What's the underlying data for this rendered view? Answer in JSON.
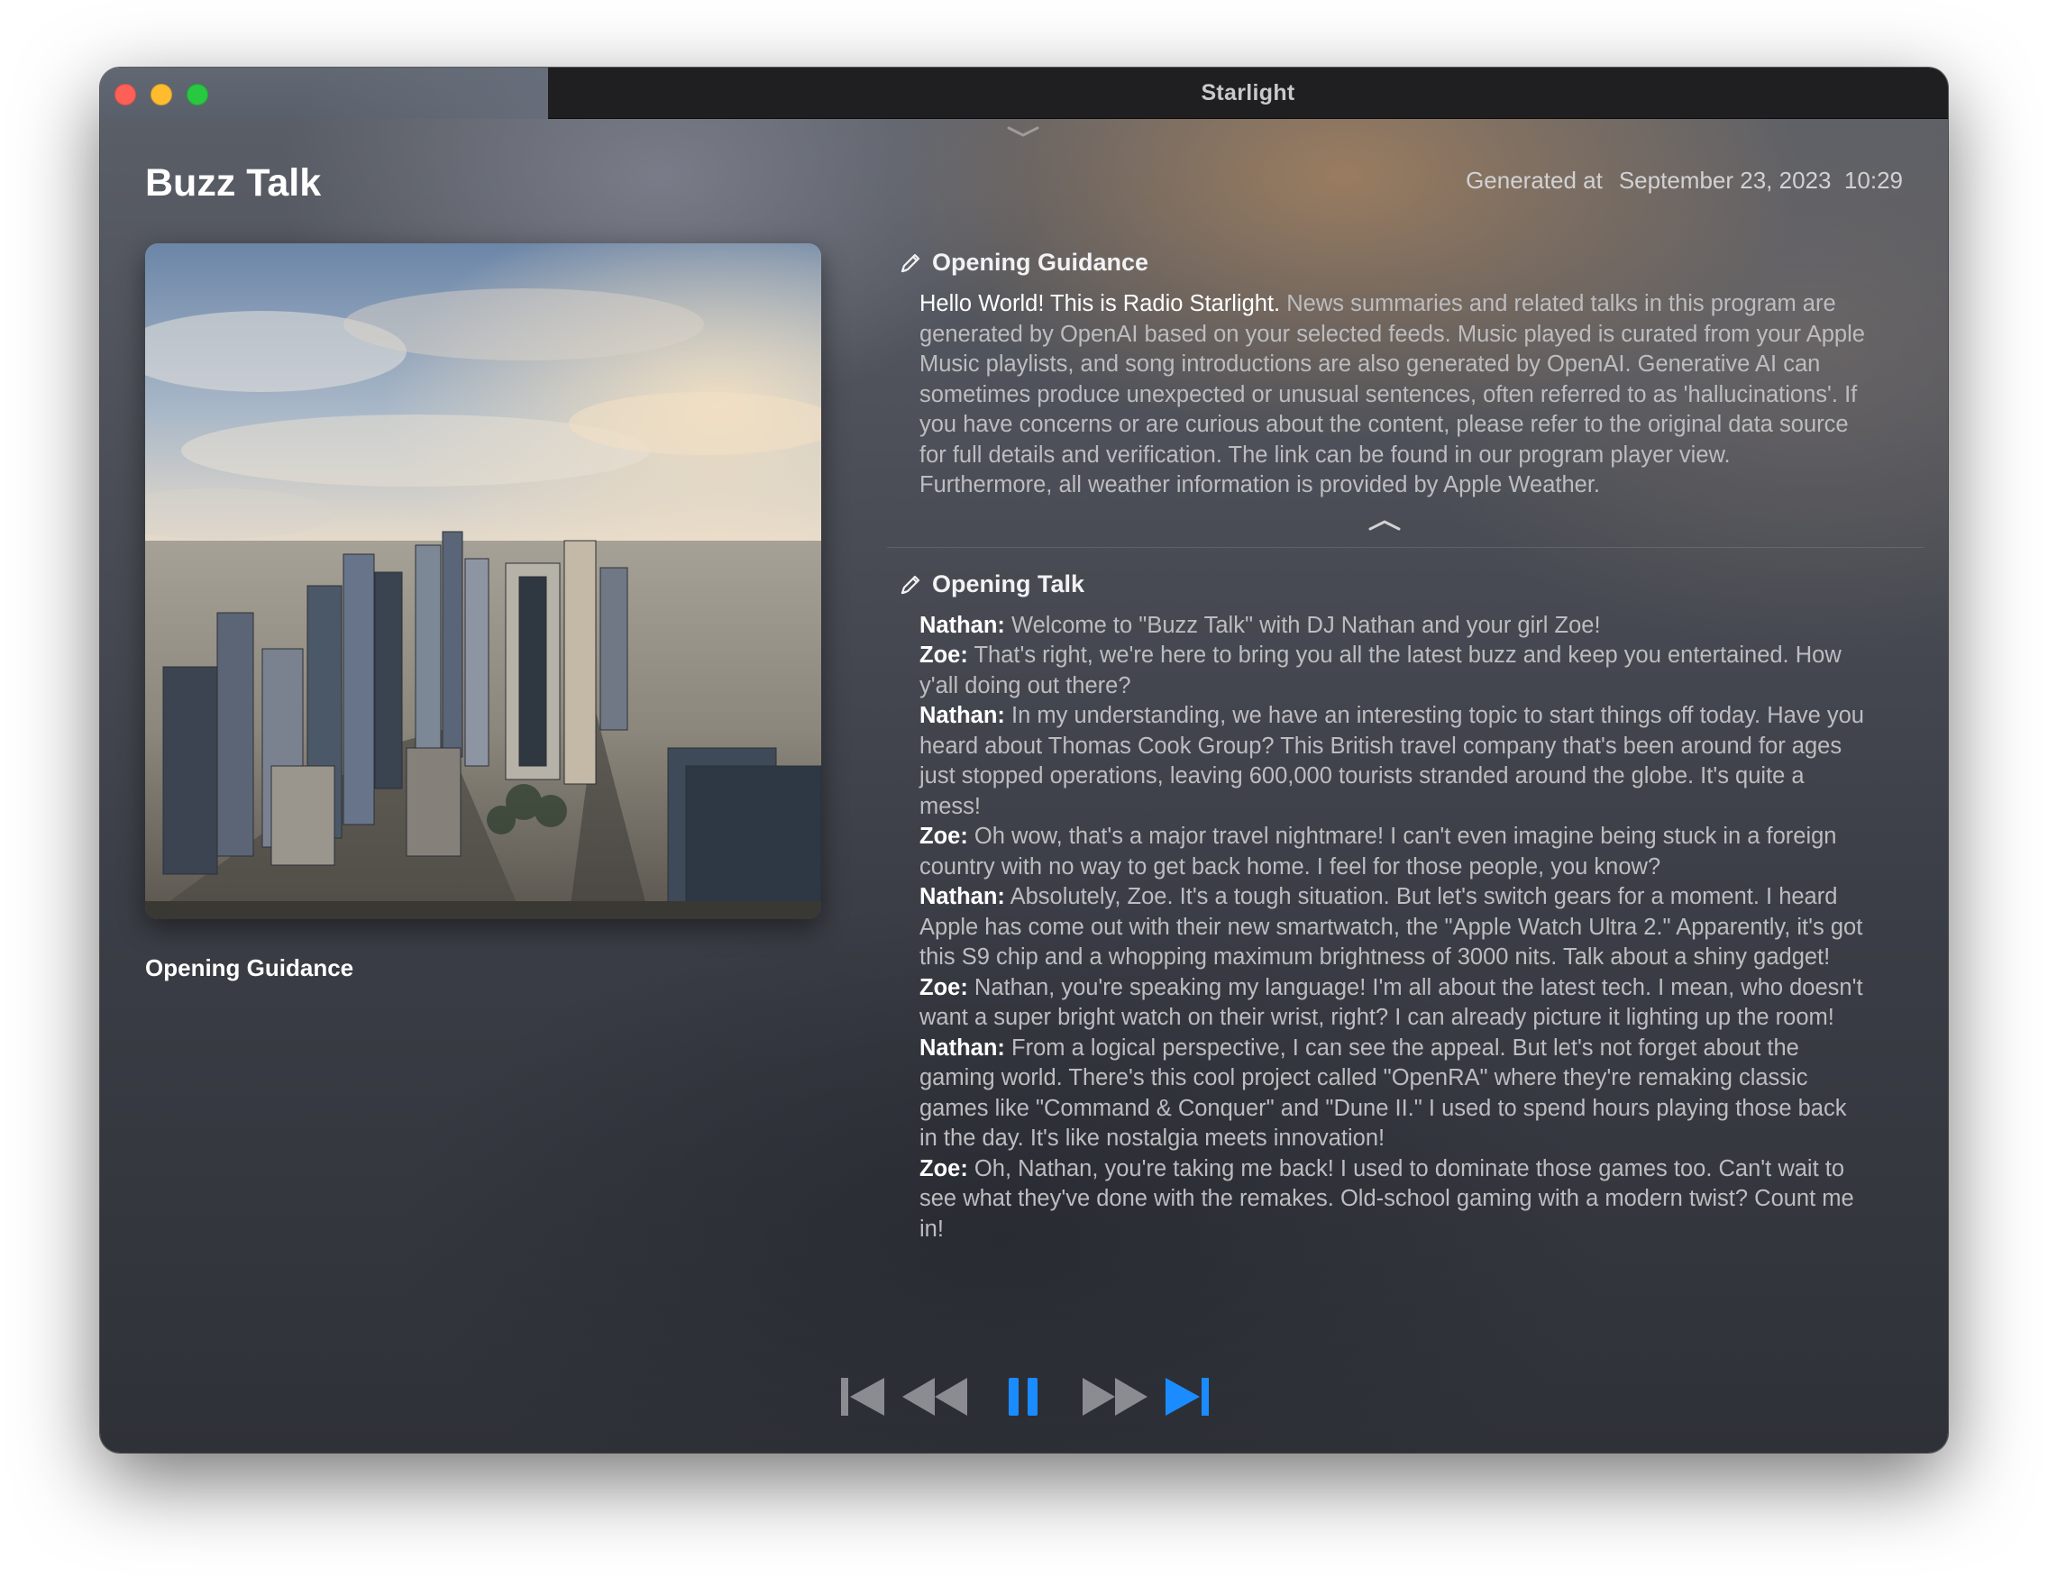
{
  "window": {
    "title": "Starlight"
  },
  "header": {
    "app_title": "Buzz Talk",
    "generated_label": "Generated at",
    "generated_date": "September 23, 2023",
    "generated_time": "10:29"
  },
  "artwork": {
    "caption": "Opening Guidance"
  },
  "sections": {
    "guidance": {
      "heading": "Opening Guidance",
      "lead": "Hello World! This is Radio Starlight.",
      "body": "News summaries and related talks in this program are generated by OpenAI based on your selected feeds. Music played is curated from your Apple Music playlists, and song introductions are also generated by OpenAI. Generative AI can sometimes produce unexpected or unusual sentences, often referred to as 'hallucinations'. If you have concerns or are curious about the content, please refer to the original data source for full details and verification. The link can be found in our program player view. Furthermore, all weather information is provided by Apple Weather."
    },
    "talk": {
      "heading": "Opening Talk",
      "lines": [
        {
          "speaker": "Nathan:",
          "text": "Welcome to \"Buzz Talk\" with DJ Nathan and your girl Zoe!"
        },
        {
          "speaker": "Zoe:",
          "text": "That's right, we're here to bring you all the latest buzz and keep you entertained. How y'all doing out there?"
        },
        {
          "speaker": "Nathan:",
          "text": "In my understanding, we have an interesting topic to start things off today. Have you heard about Thomas Cook Group? This British travel company that's been around for ages just stopped operations, leaving 600,000 tourists stranded around the globe. It's quite a mess!"
        },
        {
          "speaker": "Zoe:",
          "text": "Oh wow, that's a major travel nightmare! I can't even imagine being stuck in a foreign country with no way to get back home. I feel for those people, you know?"
        },
        {
          "speaker": "Nathan:",
          "text": "Absolutely, Zoe. It's a tough situation. But let's switch gears for a moment. I heard Apple has come out with their new smartwatch, the \"Apple Watch Ultra 2.\" Apparently, it's got this S9 chip and a whopping maximum brightness of 3000 nits. Talk about a shiny gadget!"
        },
        {
          "speaker": "Zoe:",
          "text": "Nathan, you're speaking my language! I'm all about the latest tech. I mean, who doesn't want a super bright watch on their wrist, right? I can already picture it lighting up the room!"
        },
        {
          "speaker": "Nathan:",
          "text": "From a logical perspective, I can see the appeal. But let's not forget about the gaming world. There's this cool project called \"OpenRA\" where they're remaking classic games like \"Command & Conquer\" and \"Dune II.\" I used to spend hours playing those back in the day. It's like nostalgia meets innovation!"
        },
        {
          "speaker": "Zoe:",
          "text": "Oh, Nathan, you're taking me back! I used to dominate those games too. Can't wait to see what they've done with the remakes. Old-school gaming with a modern twist? Count me in!"
        }
      ]
    }
  },
  "player": {
    "buttons": [
      {
        "name": "skip-to-start-icon",
        "state": "disabled"
      },
      {
        "name": "rewind-icon",
        "state": "disabled"
      },
      {
        "name": "pause-icon",
        "state": "active"
      },
      {
        "name": "fast-forward-icon",
        "state": "disabled"
      },
      {
        "name": "skip-to-next-icon",
        "state": "active"
      }
    ],
    "colors": {
      "active": "#1a8cff",
      "disabled": "#8a8c92"
    }
  },
  "colors": {
    "close": "#fe5f57",
    "minimize": "#febc2e",
    "maximize": "#28c840"
  }
}
